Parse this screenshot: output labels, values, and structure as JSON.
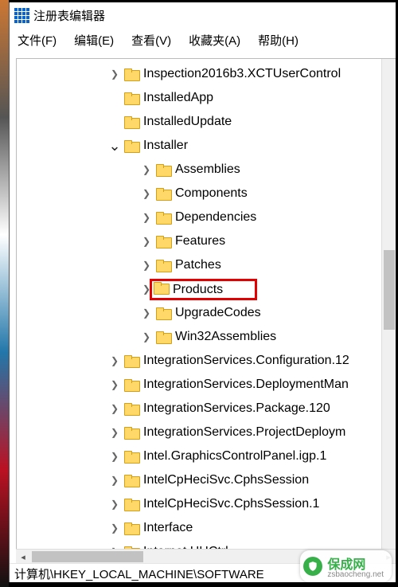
{
  "window": {
    "title": "注册表编辑器"
  },
  "menu": {
    "file": "文件(F)",
    "edit": "编辑(E)",
    "view": "查看(V)",
    "favorites": "收藏夹(A)",
    "help": "帮助(H)"
  },
  "tree": {
    "items": [
      {
        "indent": 115,
        "expander": ">",
        "label": "Inspection2016b3.XCTUserControl"
      },
      {
        "indent": 115,
        "expander": "",
        "label": "InstalledApp"
      },
      {
        "indent": 115,
        "expander": "",
        "label": "InstalledUpdate"
      },
      {
        "indent": 115,
        "expander": "v",
        "label": "Installer"
      },
      {
        "indent": 155,
        "expander": ">",
        "label": "Assemblies"
      },
      {
        "indent": 155,
        "expander": ">",
        "label": "Components"
      },
      {
        "indent": 155,
        "expander": ">",
        "label": "Dependencies"
      },
      {
        "indent": 155,
        "expander": ">",
        "label": "Features"
      },
      {
        "indent": 155,
        "expander": ">",
        "label": "Patches"
      },
      {
        "indent": 155,
        "expander": ">",
        "label": "Products",
        "highlight": true
      },
      {
        "indent": 155,
        "expander": ">",
        "label": "UpgradeCodes"
      },
      {
        "indent": 155,
        "expander": ">",
        "label": "Win32Assemblies"
      },
      {
        "indent": 115,
        "expander": ">",
        "label": "IntegrationServices.Configuration.12"
      },
      {
        "indent": 115,
        "expander": ">",
        "label": "IntegrationServices.DeploymentMan"
      },
      {
        "indent": 115,
        "expander": ">",
        "label": "IntegrationServices.Package.120"
      },
      {
        "indent": 115,
        "expander": ">",
        "label": "IntegrationServices.ProjectDeploym"
      },
      {
        "indent": 115,
        "expander": ">",
        "label": "Intel.GraphicsControlPanel.igp.1"
      },
      {
        "indent": 115,
        "expander": ">",
        "label": "IntelCpHeciSvc.CphsSession"
      },
      {
        "indent": 115,
        "expander": ">",
        "label": "IntelCpHeciSvc.CphsSession.1"
      },
      {
        "indent": 115,
        "expander": ">",
        "label": "Interface"
      },
      {
        "indent": 115,
        "expander": ">",
        "label": "Internet.HHCtrl"
      }
    ]
  },
  "status": {
    "path": "计算机\\HKEY_LOCAL_MACHINE\\SOFTWARE"
  },
  "watermark": {
    "name": "保成网",
    "sub": "zsbaocheng.net"
  }
}
